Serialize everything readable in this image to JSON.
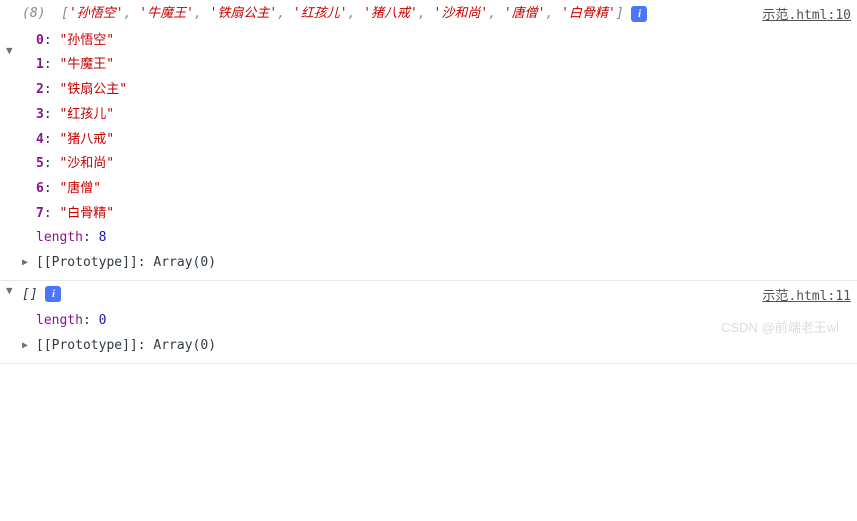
{
  "entry1": {
    "source": "示范.html:10",
    "count": "(8)",
    "items": [
      "'孙悟空'",
      "'牛魔王'",
      "'铁扇公主'",
      "'红孩儿'",
      "'猪八戒'",
      "'沙和尚'",
      "'唐僧'",
      "'白骨精'"
    ],
    "props": [
      {
        "key": "0",
        "val": "\"孙悟空\""
      },
      {
        "key": "1",
        "val": "\"牛魔王\""
      },
      {
        "key": "2",
        "val": "\"铁扇公主\""
      },
      {
        "key": "3",
        "val": "\"红孩儿\""
      },
      {
        "key": "4",
        "val": "\"猪八戒\""
      },
      {
        "key": "5",
        "val": "\"沙和尚\""
      },
      {
        "key": "6",
        "val": "\"唐僧\""
      },
      {
        "key": "7",
        "val": "\"白骨精\""
      }
    ],
    "length_label": "length",
    "length_val": "8",
    "proto_label": "[[Prototype]]",
    "proto_val": "Array(0)"
  },
  "entry2": {
    "source": "示范.html:11",
    "summary": "[]",
    "length_label": "length",
    "length_val": "0",
    "proto_label": "[[Prototype]]",
    "proto_val": "Array(0)"
  },
  "watermark": "CSDN @前端老王wl",
  "info_char": "i"
}
